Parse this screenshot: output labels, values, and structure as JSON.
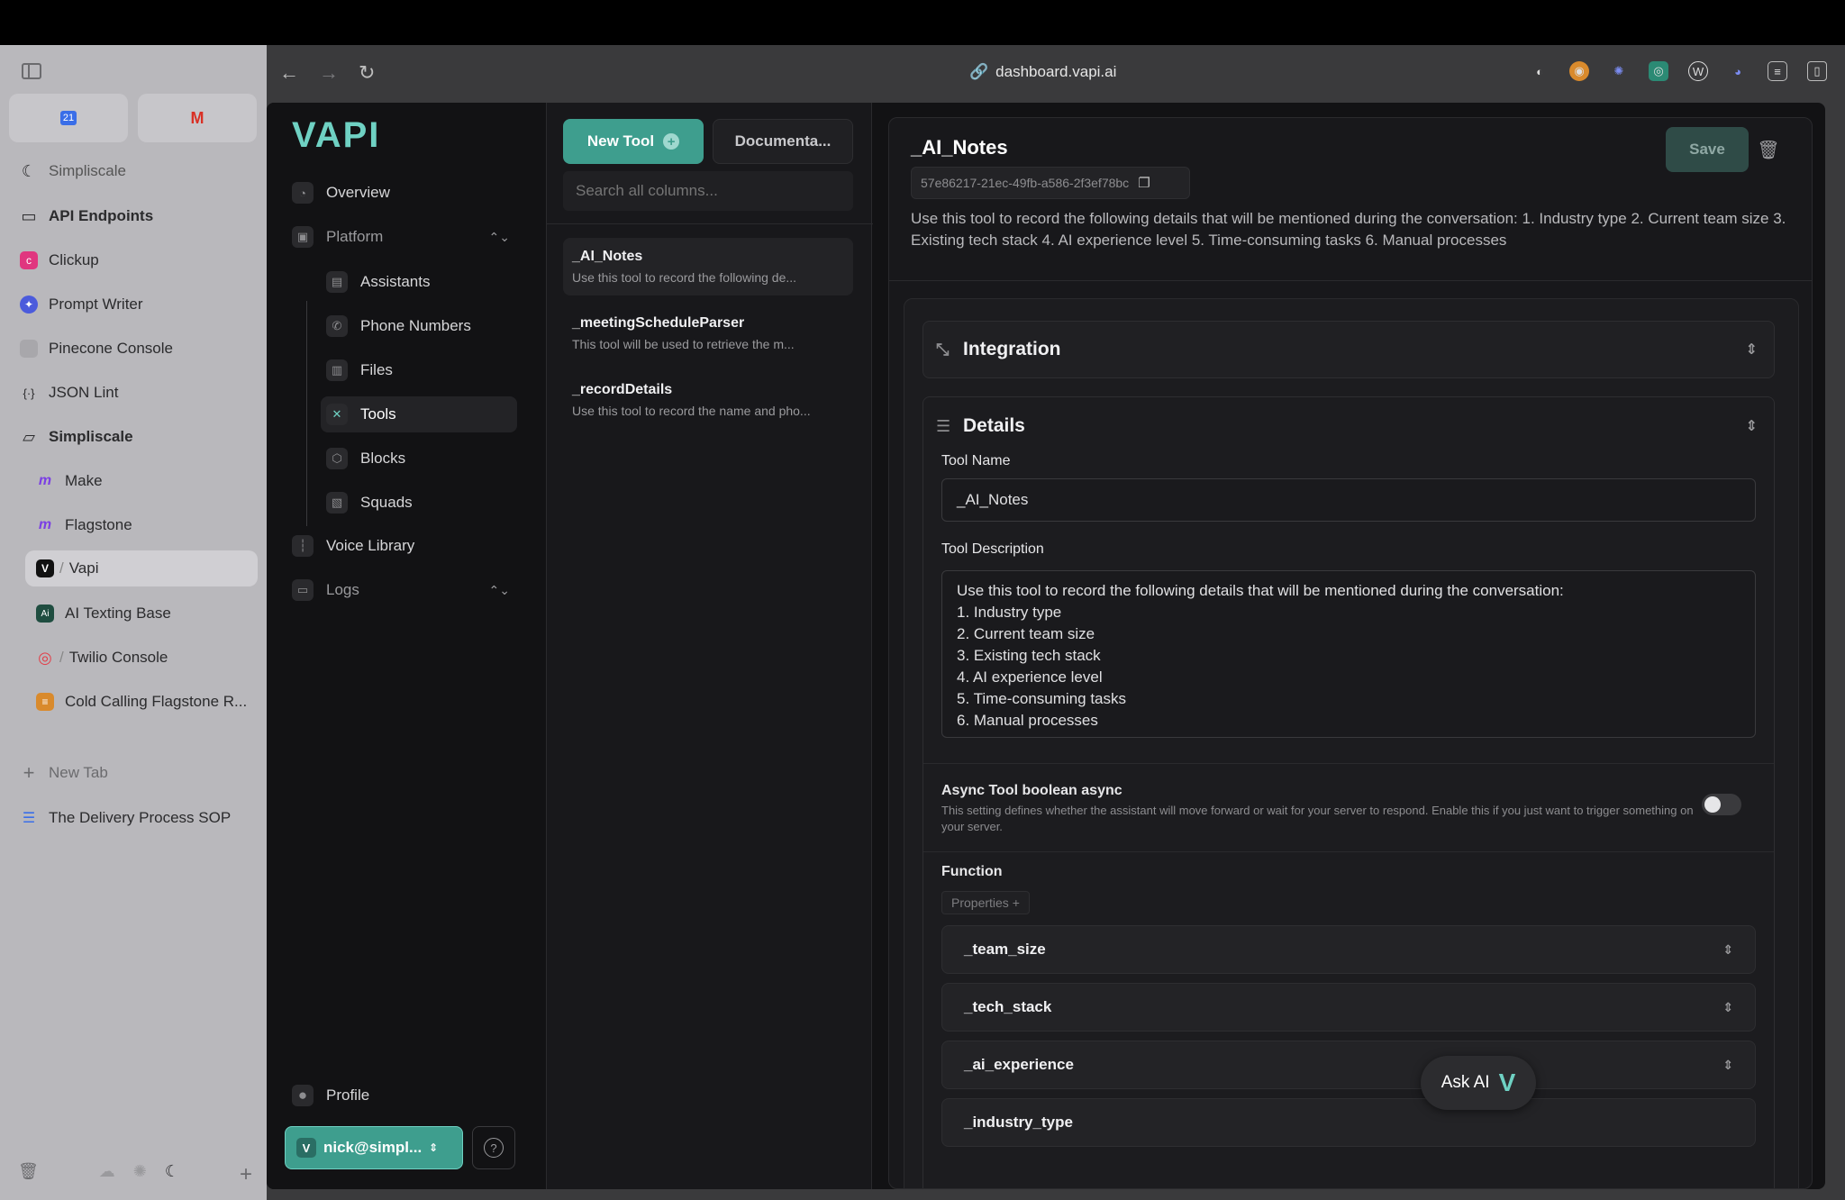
{
  "browser": {
    "url": "dashboard.vapi.ai"
  },
  "arc": {
    "favorites": [
      {
        "icon": "calendar-icon",
        "glyph": "21"
      },
      {
        "icon": "gmail-icon",
        "glyph": "M"
      }
    ],
    "items": [
      {
        "label": "Simpliscale",
        "icon": "moon-icon",
        "glyph": "☾",
        "color": "#2b2b2d"
      },
      {
        "label": "API Endpoints",
        "icon": "folder-icon",
        "glyph": "▭",
        "color": "#2b2b2d"
      },
      {
        "label": "Clickup",
        "icon": "clickup-icon",
        "glyph": "c",
        "color": "#e0367f"
      },
      {
        "label": "Prompt Writer",
        "icon": "prompt-icon",
        "glyph": "✦",
        "color": "#4b5bdc"
      },
      {
        "label": "Pinecone Console",
        "icon": "pinecone-icon",
        "glyph": "",
        "color": "#a8a7ab"
      },
      {
        "label": "JSON Lint",
        "icon": "json-icon",
        "glyph": "{·}",
        "color": "#2b2b2d"
      },
      {
        "label": "Simpliscale",
        "icon": "folder-open-icon",
        "glyph": "▱",
        "color": "#2b2b2d"
      },
      {
        "label": "Make",
        "icon": "make-icon",
        "glyph": "m",
        "color": "#7b3fe4"
      },
      {
        "label": "Flagstone",
        "icon": "make-icon",
        "glyph": "m",
        "color": "#7b3fe4"
      },
      {
        "label": "Vapi",
        "icon": "vapi-icon",
        "glyph": "V",
        "color": "#111"
      },
      {
        "label": "AI Texting Base",
        "icon": "ai-icon",
        "glyph": "Ai",
        "color": "#1f4d40"
      },
      {
        "label": "Twilio Console",
        "icon": "twilio-icon",
        "glyph": "◎",
        "color": "#e2404a"
      },
      {
        "label": "Cold Calling Flagstone R...",
        "icon": "stack-icon",
        "glyph": "≡",
        "color": "#d98a2c"
      },
      {
        "label": "New Tab",
        "icon": "plus-icon",
        "glyph": "+",
        "color": "#6b6b6e"
      },
      {
        "label": "The Delivery Process SOP",
        "icon": "doc-icon",
        "glyph": "☰",
        "color": "#3a6ee8"
      }
    ],
    "separator": "/"
  },
  "vapi": {
    "logo": "VAPI",
    "nav": {
      "overview": "Overview",
      "platform": "Platform",
      "assistants": "Assistants",
      "phone_numbers": "Phone Numbers",
      "files": "Files",
      "tools": "Tools",
      "blocks": "Blocks",
      "squads": "Squads",
      "voice_library": "Voice Library",
      "logs": "Logs",
      "profile": "Profile"
    },
    "user": "nick@simpl...",
    "help": "?"
  },
  "tools": {
    "new_tool": "New Tool",
    "documentation": "Documenta...",
    "search_placeholder": "Search all columns...",
    "list": [
      {
        "title": "_AI_Notes",
        "desc": "Use this tool to record the following de..."
      },
      {
        "title": "_meetingScheduleParser",
        "desc": "This tool will be used to retrieve the m..."
      },
      {
        "title": "_recordDetails",
        "desc": "Use this tool to record the name and pho..."
      }
    ]
  },
  "detail": {
    "title": "_AI_Notes",
    "save": "Save",
    "id": "57e86217-21ec-49fb-a586-2f3ef78bc",
    "description": "Use this tool to record the following details that will be mentioned during the conversation: 1. Industry type 2. Current team size 3. Existing tech stack 4. AI experience level 5. Time-consuming tasks 6. Manual processes",
    "integration": "Integration",
    "details": "Details",
    "tool_name_label": "Tool Name",
    "tool_name_value": "_AI_Notes",
    "tool_desc_label": "Tool Description",
    "tool_desc_value": "Use this tool to record the following details that will be mentioned during the conversation:\n1. Industry type\n2. Current team size\n3. Existing tech stack\n4. AI experience level\n5. Time-consuming tasks\n6. Manual processes",
    "async_label": "Async Tool boolean async",
    "async_note": "This setting defines whether the assistant will move forward or wait for your server to respond. Enable this if you just want to trigger something on your server.",
    "async_enabled": false,
    "function_label": "Function",
    "properties_label": "Properties +",
    "properties": [
      "_team_size",
      "_tech_stack",
      "_ai_experience",
      "_industry_type"
    ]
  },
  "ask_ai": "Ask AI",
  "colors": {
    "accent": "#3e9e8e",
    "logo": "#6fd1c3"
  }
}
